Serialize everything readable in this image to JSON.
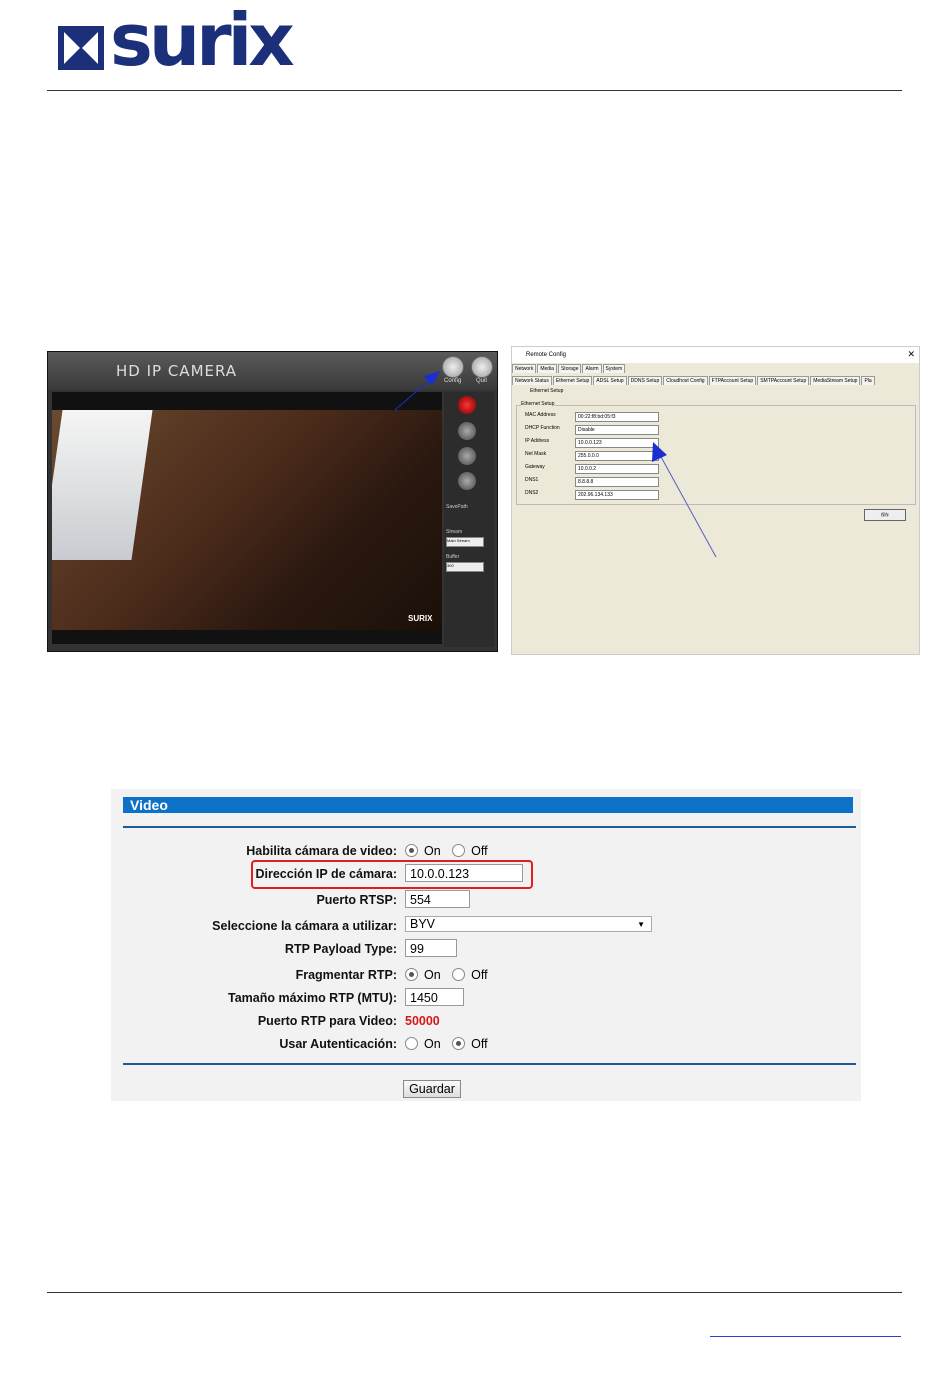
{
  "logo": {
    "word": "surix"
  },
  "camera_app": {
    "title": "HD IP CAMERA",
    "config_label": "Config",
    "quit_label": "Quit",
    "brand": "SURIX",
    "savepath_label": "SavePath",
    "stream_label": "Stream",
    "stream_value": "Main Stream",
    "buffer_label": "Buffer",
    "buffer_value": "300"
  },
  "remote_config": {
    "title": "Remote Config",
    "tabs_top": [
      "Network",
      "Media",
      "Storage",
      "Alarm",
      "System"
    ],
    "tabs_sub": [
      "Network Status",
      "Ethernet Setup",
      "ADSL Setup",
      "DDNS Setup",
      "Cloudhost Config",
      "FTPAccount Setup",
      "SMTPAccount Setup",
      "MediaStream Setup",
      "Pla"
    ],
    "section": "Ethernet Setup",
    "group": "Ethernet Setup",
    "fields": [
      {
        "label": "MAC Address",
        "value": "00:22:f8:bd:05:f3"
      },
      {
        "label": "DHCP Function",
        "value": "Disable"
      },
      {
        "label": "IP Address",
        "value": "10.0.0.123"
      },
      {
        "label": "Net Mask",
        "value": "255.0.0.0"
      },
      {
        "label": "Gateway",
        "value": "10.0.0.2"
      },
      {
        "label": "DNS1",
        "value": "8.8.8.8"
      },
      {
        "label": "DNS2",
        "value": "202.96.134.133"
      }
    ],
    "save_label": "保存"
  },
  "video_form": {
    "header": "Video",
    "enable_label": "Habilita cámara de video:",
    "on": "On",
    "off": "Off",
    "ip_label": "Dirección IP de cámara:",
    "ip_value": "10.0.0.123",
    "rtsp_label": "Puerto RTSP:",
    "rtsp_value": "554",
    "camera_label": "Seleccione la cámara a utilizar:",
    "camera_value": "BYV",
    "payload_label": "RTP Payload Type:",
    "payload_value": "99",
    "frag_label": "Fragmentar RTP:",
    "mtu_label": "Tamaño máximo RTP (MTU):",
    "mtu_value": "1450",
    "rtp_port_label": "Puerto RTP para Video:",
    "rtp_port_value": "50000",
    "auth_label": "Usar Autenticación:",
    "save_button": "Guardar"
  }
}
